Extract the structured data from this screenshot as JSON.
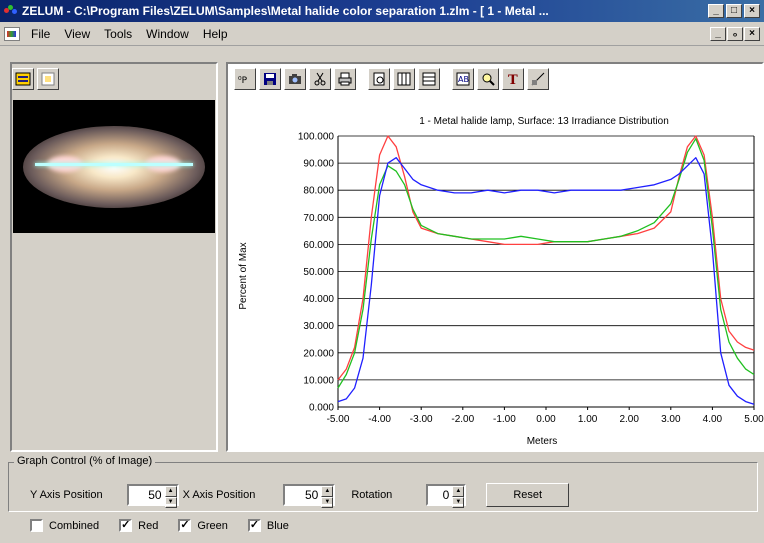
{
  "window": {
    "title": "ZELUM - C:\\Program Files\\ZELUM\\Samples\\Metal halide color separation 1.zlm - [ 1 - Metal ...",
    "buttons": [
      "_",
      "□",
      "×"
    ]
  },
  "menu": {
    "items": [
      "File",
      "View",
      "Tools",
      "Window",
      "Help"
    ],
    "mdi_buttons": [
      "_",
      "ₒ",
      "×"
    ]
  },
  "left_toolbar": {
    "icons": [
      "split-view-icon",
      "image-view-icon"
    ]
  },
  "chart_toolbar": {
    "icons": [
      "axis-labels-icon",
      "save-icon",
      "camera-icon",
      "cut-icon",
      "print-icon",
      "preview-icon",
      "vertical-grid-icon",
      "horizontal-grid-icon",
      "data-icon",
      "zoom-icon",
      "type-icon",
      "gradient-icon"
    ]
  },
  "chart_data": {
    "type": "line",
    "title": "1 - Metal halide lamp, Surface: 13 Irradiance Distribution",
    "xlabel": "Meters",
    "ylabel": "Percent of Max",
    "xlim": [
      -5,
      5
    ],
    "ylim": [
      0,
      100
    ],
    "x_ticks": [
      "-5.00",
      "-4.00",
      "-3.00",
      "-2.00",
      "-1.00",
      "0.00",
      "1.00",
      "2.00",
      "3.00",
      "4.00",
      "5.00"
    ],
    "y_ticks": [
      "0.000",
      "10.000",
      "20.000",
      "30.000",
      "40.000",
      "50.000",
      "60.000",
      "70.000",
      "80.000",
      "90.000",
      "100.000"
    ],
    "grid": "horizontal",
    "x": [
      -5.0,
      -4.8,
      -4.6,
      -4.4,
      -4.2,
      -4.0,
      -3.8,
      -3.6,
      -3.4,
      -3.2,
      -3.0,
      -2.6,
      -2.2,
      -1.8,
      -1.4,
      -1.0,
      -0.6,
      -0.2,
      0.2,
      0.6,
      1.0,
      1.4,
      1.8,
      2.2,
      2.6,
      3.0,
      3.2,
      3.4,
      3.6,
      3.8,
      4.0,
      4.2,
      4.4,
      4.6,
      4.8,
      5.0
    ],
    "series": [
      {
        "color": "#ff4040",
        "values": [
          10,
          14,
          22,
          40,
          70,
          93,
          100,
          96,
          85,
          72,
          66,
          64,
          63,
          62,
          61,
          60,
          60,
          60,
          61,
          61,
          61,
          62,
          63,
          64,
          66,
          72,
          85,
          96,
          100,
          93,
          70,
          40,
          28,
          24,
          22,
          21
        ]
      },
      {
        "color": "#20c020",
        "values": [
          7,
          12,
          20,
          36,
          62,
          82,
          89,
          87,
          82,
          73,
          67,
          64,
          63,
          62,
          62,
          62,
          63,
          62,
          61,
          61,
          61,
          62,
          63,
          65,
          68,
          75,
          84,
          94,
          99,
          91,
          66,
          36,
          24,
          18,
          14,
          12
        ]
      },
      {
        "color": "#2020ff",
        "values": [
          2,
          3,
          7,
          18,
          45,
          78,
          90,
          92,
          88,
          84,
          82,
          80,
          79,
          79,
          80,
          79,
          80,
          80,
          79,
          80,
          80,
          80,
          80,
          81,
          82,
          84,
          86,
          89,
          92,
          86,
          58,
          20,
          8,
          4,
          2,
          1
        ]
      }
    ]
  },
  "graph_control": {
    "legend": "Graph Control (% of Image)",
    "y_axis_label": "Y Axis Position",
    "y_axis_value": "50",
    "x_axis_label": "X Axis Position",
    "x_axis_value": "50",
    "rotation_label": "Rotation",
    "rotation_value": "0",
    "reset_label": "Reset"
  },
  "checkboxes": [
    {
      "label": "Combined",
      "checked": false
    },
    {
      "label": "Red",
      "checked": true
    },
    {
      "label": "Green",
      "checked": true
    },
    {
      "label": "Blue",
      "checked": true
    }
  ]
}
